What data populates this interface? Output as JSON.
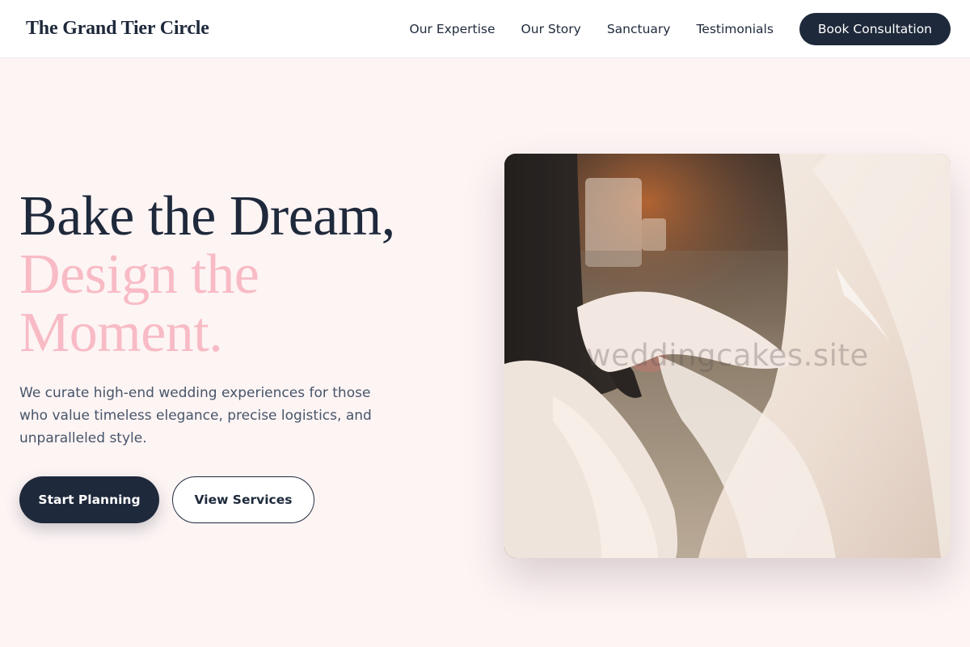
{
  "header": {
    "brand": "The Grand Tier Circle",
    "nav": [
      {
        "label": "Our Expertise"
      },
      {
        "label": "Our Story"
      },
      {
        "label": "Sanctuary"
      },
      {
        "label": "Testimonials"
      }
    ],
    "cta_label": "Book Consultation"
  },
  "hero": {
    "headline_line1": "Bake the Dream,",
    "headline_line2": "Design the",
    "headline_line3": "Moment.",
    "description": "We curate high-end wedding experiences for those who value timeless elegance, precise logistics, and unparalleled style.",
    "primary_button": "Start Planning",
    "secondary_button": "View Services",
    "image_watermark": "weddingcakes.site"
  },
  "colors": {
    "navy": "#1e293b",
    "pink_accent": "#f8bbc5",
    "page_background": "#fdf4f4",
    "body_text": "#475569"
  }
}
